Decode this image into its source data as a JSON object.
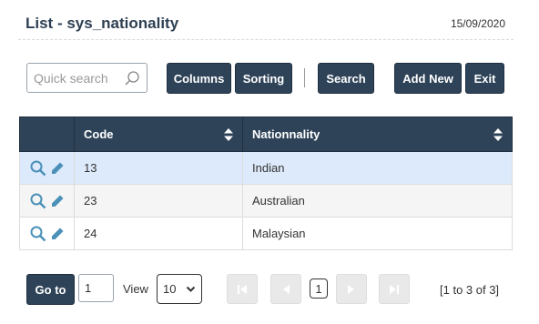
{
  "header": {
    "title": "List - sys_nationality",
    "date": "15/09/2020"
  },
  "toolbar": {
    "search_placeholder": "Quick search",
    "columns_label": "Columns",
    "sorting_label": "Sorting",
    "search_label": "Search",
    "add_new_label": "Add New",
    "exit_label": "Exit"
  },
  "table": {
    "columns": [
      "Code",
      "Nationnality"
    ],
    "rows": [
      {
        "code": "13",
        "nationality": "Indian"
      },
      {
        "code": "23",
        "nationality": "Australian"
      },
      {
        "code": "24",
        "nationality": "Malaysian"
      }
    ]
  },
  "footer": {
    "goto_label": "Go to",
    "page_value": "1",
    "view_label": "View",
    "view_value": "10",
    "current_page": "1",
    "range": "[1 to 3 of 3]"
  },
  "colors": {
    "primary": "#2e4358",
    "selected_row": "#ddeafb",
    "icon": "#4a90b8"
  },
  "icons": [
    "search-icon",
    "sort-icon",
    "magnifier-icon",
    "pencil-icon",
    "first-page-icon",
    "prev-page-icon",
    "next-page-icon",
    "last-page-icon",
    "chevron-down-icon"
  ]
}
